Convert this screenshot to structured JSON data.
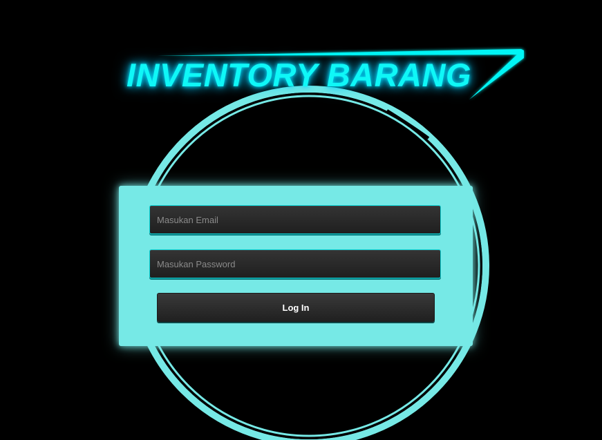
{
  "app": {
    "title": "INVENTORY BARANG"
  },
  "login": {
    "email_placeholder": "Masukan Email",
    "password_placeholder": "Masukan Password",
    "button_label": "Log In"
  },
  "colors": {
    "background": "#000000",
    "accent": "#0ff7f7",
    "card": "#76e9e6",
    "field": "#2a2a2a"
  }
}
